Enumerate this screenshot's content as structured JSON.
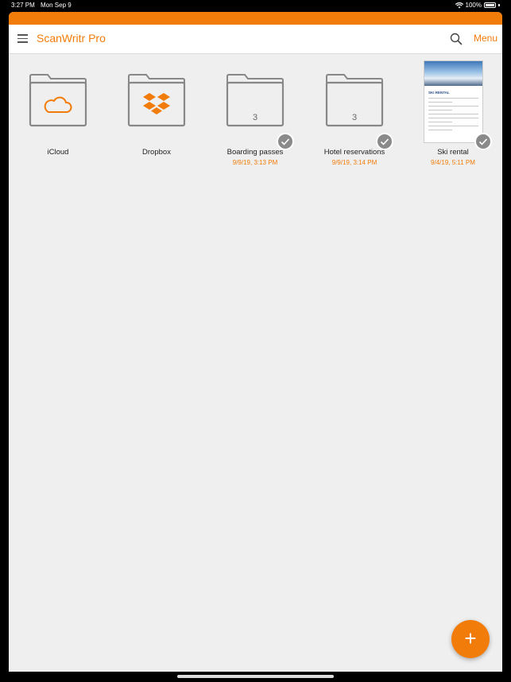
{
  "status_bar": {
    "time": "3:27 PM",
    "date": "Mon Sep 9",
    "battery": "100%"
  },
  "nav": {
    "title": "ScanWritr Pro",
    "menu_label": "Menu"
  },
  "items": [
    {
      "label": "iCloud",
      "date": "",
      "type": "folder-icloud"
    },
    {
      "label": "Dropbox",
      "date": "",
      "type": "folder-dropbox"
    },
    {
      "label": "Boarding passes",
      "date": "9/9/19, 3:13 PM",
      "count": "3",
      "type": "folder"
    },
    {
      "label": "Hotel reservations",
      "date": "9/9/19, 3:14 PM",
      "count": "3",
      "type": "folder"
    },
    {
      "label": "Ski rental",
      "date": "9/4/19, 5:11 PM",
      "type": "document",
      "doc_heading": "SKI RENTAL"
    }
  ],
  "fab_symbol": "+",
  "colors": {
    "accent": "#f27c0a",
    "folder_stroke": "#888888",
    "background": "#efefef"
  },
  "icons": [
    "menu-icon",
    "search-icon",
    "cloud-icon",
    "dropbox-icon",
    "checkmark-icon",
    "plus-icon",
    "wifi-icon",
    "battery-icon"
  ]
}
